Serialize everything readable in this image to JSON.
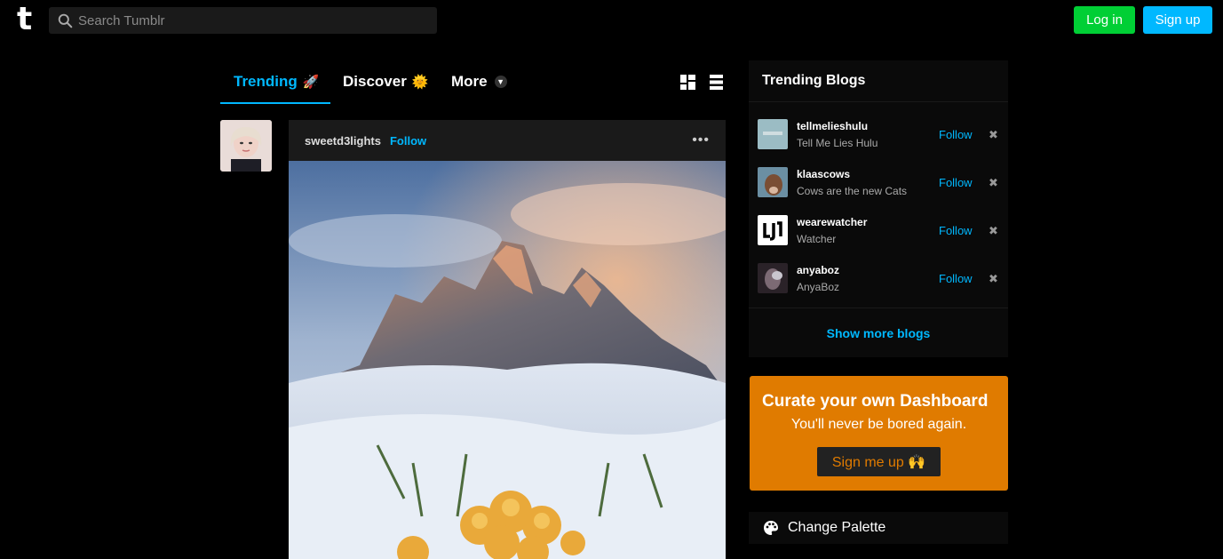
{
  "topbar": {
    "logo": "t",
    "search_placeholder": "Search Tumblr",
    "login_label": "Log in",
    "signup_label": "Sign up",
    "login_color": "#00cf35",
    "signup_color": "#00b8ff"
  },
  "tabs": [
    {
      "label": "Trending",
      "emoji": "🚀",
      "active": true
    },
    {
      "label": "Discover",
      "emoji": "🌞",
      "active": false
    },
    {
      "label": "More",
      "emoji": "",
      "active": false
    }
  ],
  "view_toggles": [
    "grid-view-icon",
    "list-view-icon"
  ],
  "post": {
    "username": "sweetd3lights",
    "follow_label": "Follow",
    "menu": "•••"
  },
  "trending_blogs": {
    "title": "Trending Blogs",
    "items": [
      {
        "name": "tellmelieshulu",
        "description": "Tell Me Lies Hulu",
        "follow": "Follow",
        "dismiss": "✖"
      },
      {
        "name": "klaascows",
        "description": "Cows are the new Cats",
        "follow": "Follow",
        "dismiss": "✖"
      },
      {
        "name": "wearewatcher",
        "description": "Watcher",
        "follow": "Follow",
        "dismiss": "✖"
      },
      {
        "name": "anyaboz",
        "description": "AnyaBoz",
        "follow": "Follow",
        "dismiss": "✖"
      }
    ],
    "show_more": "Show more blogs"
  },
  "curate": {
    "title": "Curate your own Dashboard",
    "subtitle": "You'll never be bored again.",
    "button": "Sign me up 🙌",
    "color": "#e07b00"
  },
  "palette": {
    "label": "Change Palette"
  }
}
